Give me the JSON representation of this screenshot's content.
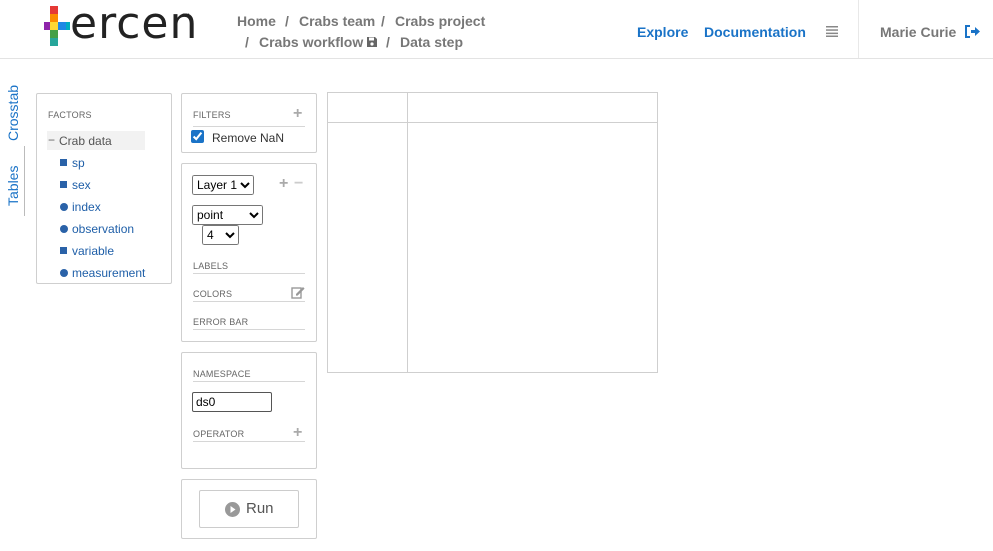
{
  "header": {
    "logo_text": "ercen",
    "logo_tm": "™",
    "breadcrumb": {
      "home": "Home",
      "team": "Crabs team",
      "project": "Crabs project",
      "workflow": "Crabs workflow",
      "step": "Data step",
      "sep": "/"
    },
    "nav": {
      "explore": "Explore",
      "documentation": "Documentation"
    },
    "user": "Marie Curie"
  },
  "side_tabs": {
    "crosstab": "Crosstab",
    "tables": "Tables"
  },
  "factors": {
    "title": "FACTORS",
    "group": {
      "collapse_symbol": "−",
      "label": "Crab data"
    },
    "items": [
      {
        "label": "sp",
        "type": "square"
      },
      {
        "label": "sex",
        "type": "square"
      },
      {
        "label": "index",
        "type": "circle"
      },
      {
        "label": "observation",
        "type": "circle"
      },
      {
        "label": "variable",
        "type": "square"
      },
      {
        "label": "measurement",
        "type": "circle"
      }
    ]
  },
  "filters": {
    "title": "FILTERS",
    "remove_nan_label": "Remove NaN",
    "remove_nan_checked": true
  },
  "layer": {
    "layer_options": [
      "Layer 1"
    ],
    "selected_layer": "Layer 1",
    "chart_options": [
      "point"
    ],
    "selected_chart": "point",
    "size_options": [
      "4"
    ],
    "selected_size": "4",
    "labels_title": "LABELS",
    "colors_title": "COLORS",
    "error_bar_title": "ERROR BAR"
  },
  "namespace": {
    "title": "NAMESPACE",
    "value": "ds0",
    "operator_title": "OPERATOR"
  },
  "run": {
    "label": "Run"
  },
  "colors": {
    "accent": "#1a73c7",
    "factor_blue": "#2a62a8"
  }
}
